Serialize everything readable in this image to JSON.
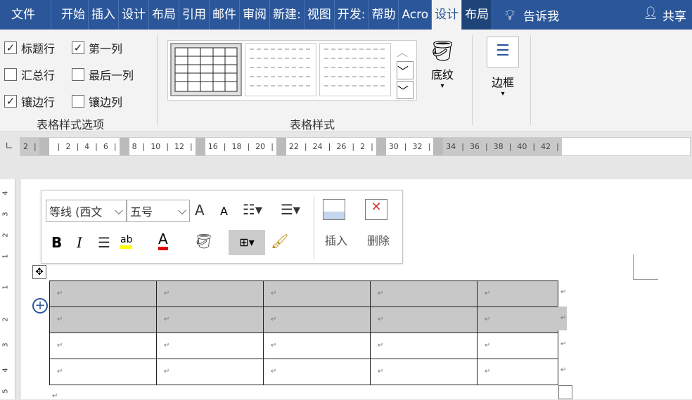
{
  "tabs": [
    "文件",
    "开始",
    "插入",
    "设计",
    "布局",
    "引用",
    "邮件",
    "审阅",
    "新建:",
    "视图",
    "开发:",
    "帮助",
    "Acro",
    "设计",
    "布局"
  ],
  "tell_me": "告诉我",
  "share": "共享",
  "options": {
    "header_row": "标题行",
    "first_column": "第一列",
    "total_row": "汇总行",
    "last_column": "最后一列",
    "banded_rows": "镶边行",
    "banded_columns": "镶边列",
    "group_label": "表格样式选项",
    "checked": {
      "header_row": true,
      "first_column": true,
      "total_row": false,
      "last_column": false,
      "banded_rows": true,
      "banded_columns": false
    }
  },
  "styles": {
    "group_label": "表格样式",
    "shading": "底纹",
    "borders": "边框"
  },
  "ruler": [
    [
      "2"
    ],
    [
      "",
      "2",
      "4",
      "6"
    ],
    [
      "8",
      "10",
      "12"
    ],
    [
      "16",
      "18",
      "20"
    ],
    [
      "22",
      "24",
      "26",
      "2"
    ],
    [
      "30",
      "32"
    ],
    [
      "34",
      "36",
      "38",
      "40",
      "42"
    ]
  ],
  "vruler": [
    "4",
    "3",
    "2",
    "1",
    "1",
    "2",
    "3",
    "4",
    "5"
  ],
  "mini": {
    "font": "等线 (西文",
    "size": "五号",
    "bold": "B",
    "italic": "I",
    "insert": "插入",
    "delete": "删除",
    "grow": "A",
    "shrink": "A",
    "font_color": "A",
    "highlight": "ab"
  },
  "colors": {
    "tab_bg": "#2b579a",
    "highlight": "#ffff00",
    "font_color": "#e00000"
  },
  "table": {
    "rows": 4,
    "cols": 5,
    "highlighted_rows": 2,
    "cell_mark": "↵"
  }
}
